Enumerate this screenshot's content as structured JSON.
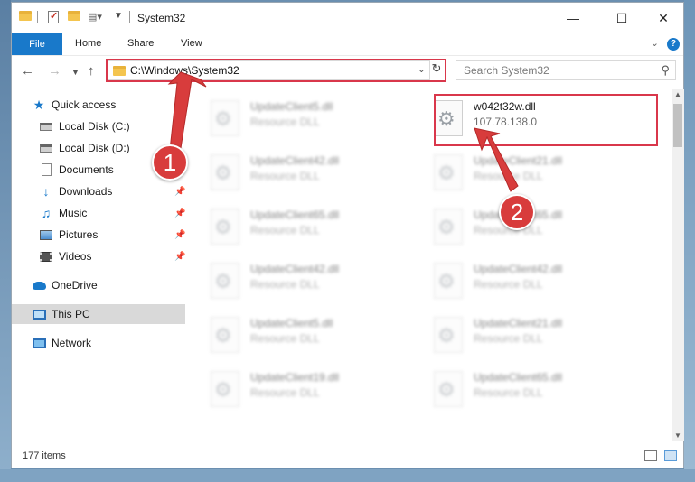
{
  "window": {
    "title": "System32"
  },
  "ribbon": {
    "tabs": [
      "File",
      "Home",
      "Share",
      "View"
    ]
  },
  "nav": {
    "address": "C:\\Windows\\System32",
    "search_placeholder": "Search System32"
  },
  "sidebar": {
    "items": [
      {
        "label": "Quick access",
        "icon": "star-icon"
      },
      {
        "label": "Local Disk (C:)",
        "icon": "disk-icon"
      },
      {
        "label": "Local Disk (D:)",
        "icon": "disk-icon"
      },
      {
        "label": "Documents",
        "icon": "document-icon"
      },
      {
        "label": "Downloads",
        "icon": "download-icon"
      },
      {
        "label": "Music",
        "icon": "music-icon"
      },
      {
        "label": "Pictures",
        "icon": "pictures-icon"
      },
      {
        "label": "Videos",
        "icon": "videos-icon"
      },
      {
        "label": "OneDrive",
        "icon": "cloud-icon"
      },
      {
        "label": "This PC",
        "icon": "computer-icon"
      },
      {
        "label": "Network",
        "icon": "network-icon"
      }
    ]
  },
  "files": [
    {
      "name": "UpdateClient5.dll",
      "type": "Resource DLL"
    },
    {
      "name": "w042t32w.dll",
      "type": "107.78.138.0"
    },
    {
      "name": "UpdateClient42.dll",
      "type": "Resource DLL"
    },
    {
      "name": "UpdateClient21.dll",
      "type": "Resource DLL"
    },
    {
      "name": "UpdateClient65.dll",
      "type": "Resource DLL"
    },
    {
      "name": "UpdateClient65.dll",
      "type": "Resource DLL"
    },
    {
      "name": "UpdateClient42.dll",
      "type": "Resource DLL"
    },
    {
      "name": "UpdateClient42.dll",
      "type": "Resource DLL"
    },
    {
      "name": "UpdateClient5.dll",
      "type": "Resource DLL"
    },
    {
      "name": "UpdateClient21.dll",
      "type": "Resource DLL"
    },
    {
      "name": "UpdateClient19.dll",
      "type": "Resource DLL"
    },
    {
      "name": "UpdateClient65.dll",
      "type": "Resource DLL"
    }
  ],
  "status": {
    "items": "177 items"
  },
  "annotations": {
    "step1": "1",
    "step2": "2"
  },
  "colors": {
    "accent": "#1979ca",
    "highlight": "#d9374b",
    "arrow": "#d83c3c"
  }
}
